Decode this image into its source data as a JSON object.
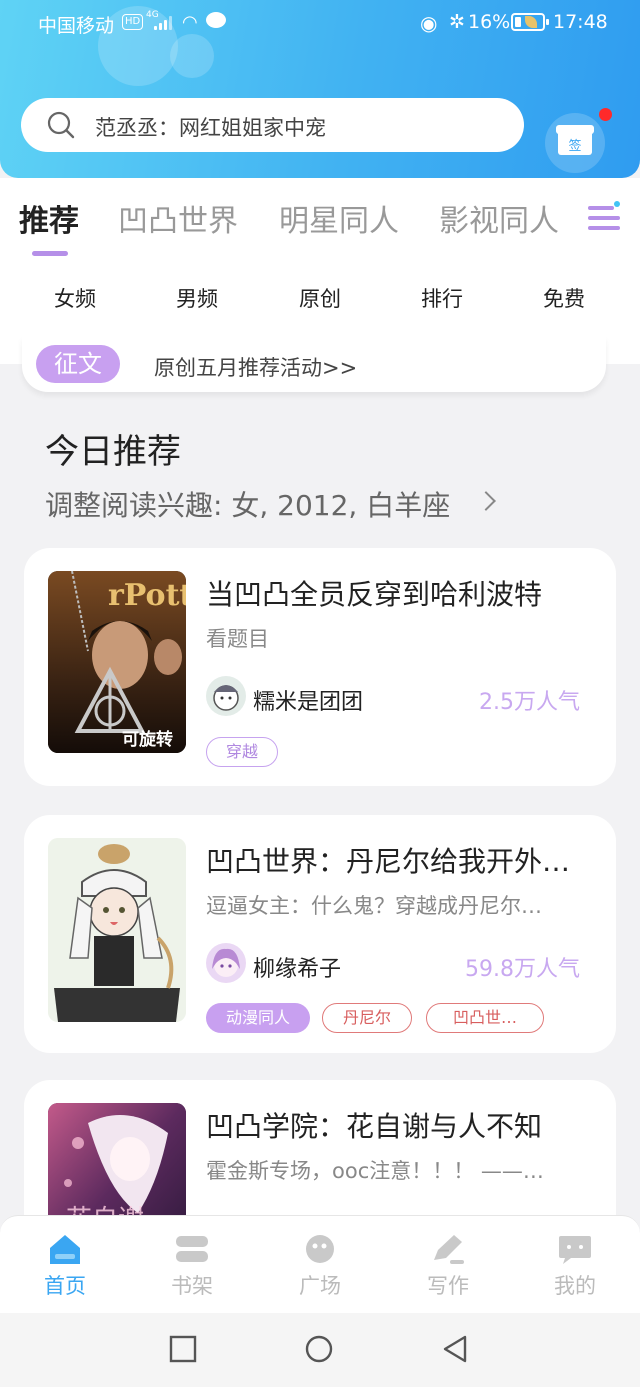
{
  "status_bar": {
    "carrier": "中国移动",
    "hd": "HD",
    "network": "4G",
    "battery_percent": "16%",
    "time": "17:48"
  },
  "search": {
    "placeholder": "范丞丞：网红姐姐家中宠"
  },
  "sign_in": {
    "label": "签"
  },
  "category_tabs": [
    {
      "label": "推荐",
      "active": true
    },
    {
      "label": "凹凸世界",
      "active": false
    },
    {
      "label": "明星同人",
      "active": false
    },
    {
      "label": "影视同人",
      "active": false
    }
  ],
  "sub_nav": [
    "女频",
    "男频",
    "原创",
    "排行",
    "免费"
  ],
  "notice": {
    "badge": "征文",
    "text": "原创五月推荐活动>>"
  },
  "recommend": {
    "title": "今日推荐",
    "subtitle": "调整阅读兴趣: 女, 2012, 白羊座"
  },
  "books": [
    {
      "title": "当凹凸全员反穿到哈利波特",
      "desc": "看题目",
      "author": "糯米是团团",
      "popularity": "2.5万人气",
      "cover_text": "可旋转",
      "tags": [
        {
          "label": "穿越",
          "style": "outline-purple"
        }
      ]
    },
    {
      "title": "凹凸世界：丹尼尔给我开外…",
      "desc": "逗逼女主：什么鬼？穿越成丹尼尔…",
      "author": "柳缘希子",
      "popularity": "59.8万人气",
      "tags": [
        {
          "label": "动漫同人",
          "style": "fill-purple"
        },
        {
          "label": "丹尼尔",
          "style": "outline-red"
        },
        {
          "label": "凹凸世…",
          "style": "outline-red"
        }
      ]
    },
    {
      "title": "凹凸学院：花自谢与人不知",
      "desc": "霍金斯专场，ooc注意！！！ ——…",
      "tags": []
    }
  ],
  "bottom_nav": [
    {
      "label": "首页",
      "icon": "home-icon",
      "active": true
    },
    {
      "label": "书架",
      "icon": "bookshelf-icon",
      "active": false
    },
    {
      "label": "广场",
      "icon": "planet-icon",
      "active": false
    },
    {
      "label": "写作",
      "icon": "pen-icon",
      "active": false
    },
    {
      "label": "我的",
      "icon": "chat-icon",
      "active": false
    }
  ],
  "colors": {
    "header_gradient_start": "#5fd3f5",
    "header_gradient_end": "#2f9cf0",
    "accent_purple": "#b58fe8",
    "accent_blue": "#3aa6f2",
    "tag_red": "#e07a7a"
  }
}
